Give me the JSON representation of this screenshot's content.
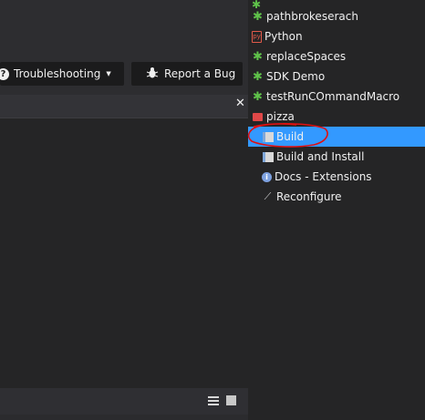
{
  "toolbar": {
    "troubleshooting_label": "Troubleshooting",
    "report_bug_label": "Report a Bug"
  },
  "menu": {
    "items": [
      {
        "label": "pathbrokeserach",
        "icon": "gear-icon"
      },
      {
        "label": "Python",
        "icon": "python-file-icon"
      },
      {
        "label": "replaceSpaces",
        "icon": "gear-icon"
      },
      {
        "label": "SDK Demo",
        "icon": "gear-icon"
      },
      {
        "label": "testRunCOmmandMacro",
        "icon": "gear-icon"
      },
      {
        "label": "pizza",
        "icon": "folder-icon"
      },
      {
        "label": "Build",
        "icon": "document-icon",
        "selected": true
      },
      {
        "label": "Build and Install",
        "icon": "document-icon"
      },
      {
        "label": "Docs - Extensions",
        "icon": "info-icon"
      },
      {
        "label": "Reconfigure",
        "icon": "wrench-icon"
      }
    ]
  },
  "colors": {
    "selection": "#3399ff",
    "gear": "#5fc24a",
    "folder": "#e04848",
    "annotation": "#e01010"
  }
}
